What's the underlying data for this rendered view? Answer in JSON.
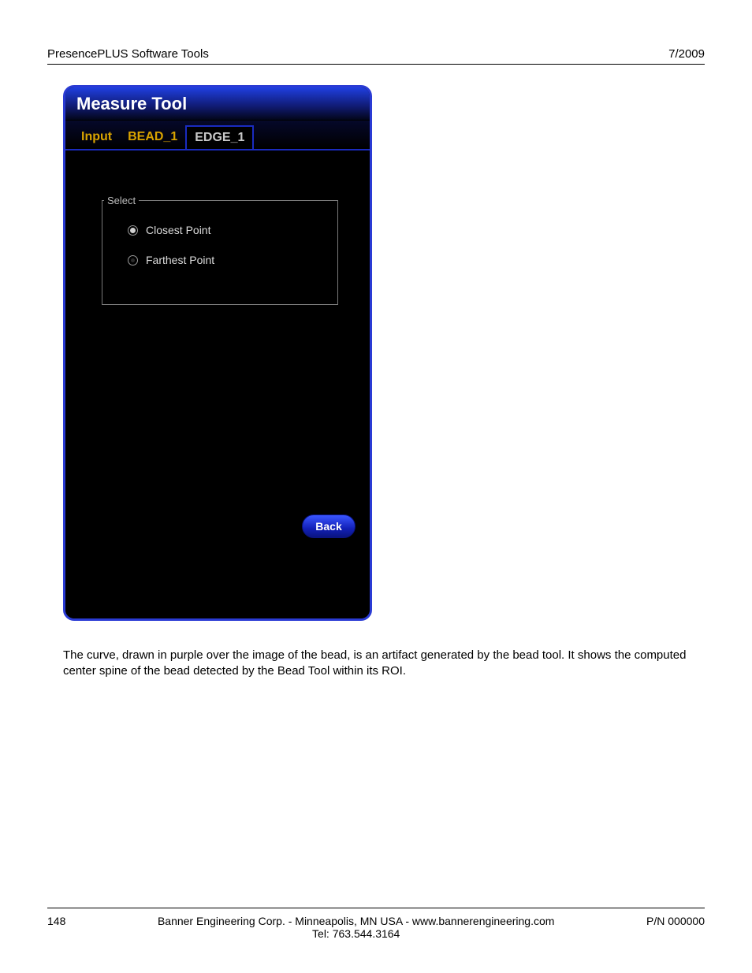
{
  "header": {
    "left": "PresencePLUS Software Tools",
    "right": "7/2009"
  },
  "panel": {
    "title": "Measure Tool",
    "tabs": {
      "lead_label": "Input",
      "items": [
        "BEAD_1",
        "EDGE_1"
      ],
      "active_index": 1
    },
    "group": {
      "legend": "Select",
      "options": [
        {
          "label": "Closest Point",
          "selected": true
        },
        {
          "label": "Farthest Point",
          "selected": false
        }
      ]
    },
    "back_label": "Back"
  },
  "body_paragraph": "The curve, drawn in purple over the image of the bead, is an artifact generated by the bead tool. It shows the computed center spine of the bead detected by the Bead Tool within its ROI.",
  "footer": {
    "page_number": "148",
    "center_line1": "Banner Engineering Corp. - Minneapolis, MN USA - www.bannerengineering.com",
    "center_line2": "Tel: 763.544.3164",
    "right": "P/N 000000"
  }
}
